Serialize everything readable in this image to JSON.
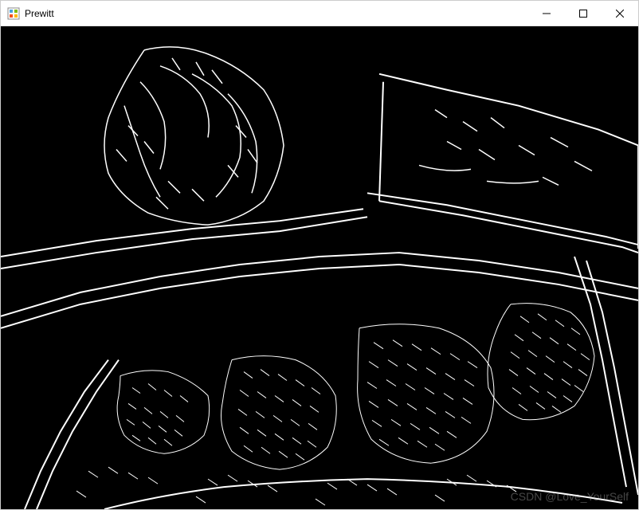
{
  "window": {
    "title": "Prewitt",
    "icon_name": "app-icon"
  },
  "titlebar_controls": {
    "minimize_label": "Minimize",
    "maximize_label": "Maximize",
    "close_label": "Close"
  },
  "content": {
    "description": "Prewitt edge-detection output image",
    "image_type": "binary-edge-map",
    "background_color": "#000000",
    "edge_color": "#ffffff"
  },
  "watermark": {
    "text": "CSDN @Love_YourSelf"
  }
}
